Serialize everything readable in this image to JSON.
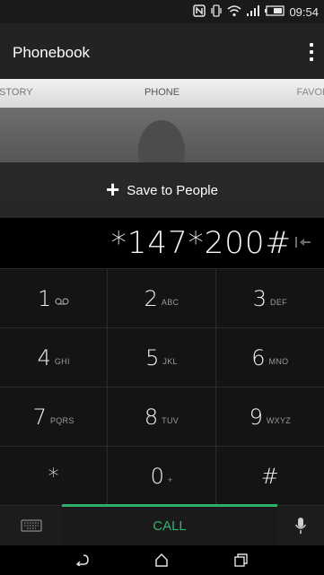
{
  "status_bar": {
    "time": "09:54",
    "icons": [
      "nfc-icon",
      "vibrate-icon",
      "wifi-icon",
      "signal-icon",
      "battery-icon"
    ]
  },
  "app_bar": {
    "title": "Phonebook",
    "menu_icon": "overflow-menu-icon"
  },
  "tabs": [
    {
      "label": "ISTORY"
    },
    {
      "label": "PHONE",
      "selected": true
    },
    {
      "label": "FAVOR"
    }
  ],
  "contact": {
    "save_label": "Save to People",
    "icon": "plus-icon"
  },
  "dialer": {
    "number": "*147*200#",
    "backspace_icon": "backspace-icon"
  },
  "keys": [
    {
      "digit": "1",
      "letters": "voicemail-icon"
    },
    {
      "digit": "2",
      "letters": "ABC"
    },
    {
      "digit": "3",
      "letters": "DEF"
    },
    {
      "digit": "4",
      "letters": "GHI"
    },
    {
      "digit": "5",
      "letters": "JKL"
    },
    {
      "digit": "6",
      "letters": "MNO"
    },
    {
      "digit": "7",
      "letters": "PQRS"
    },
    {
      "digit": "8",
      "letters": "TUV"
    },
    {
      "digit": "9",
      "letters": "WXYZ"
    },
    {
      "digit": "*",
      "letters": ""
    },
    {
      "digit": "0",
      "letters": "+"
    },
    {
      "digit": "#",
      "letters": ""
    }
  ],
  "call_row": {
    "call_label": "CALL",
    "accent_color": "#2fae6a",
    "keyboard_icon": "keyboard-icon",
    "mic_icon": "microphone-icon"
  },
  "nav_bar": {
    "icons": [
      "back-icon",
      "home-icon",
      "recent-apps-icon"
    ]
  }
}
